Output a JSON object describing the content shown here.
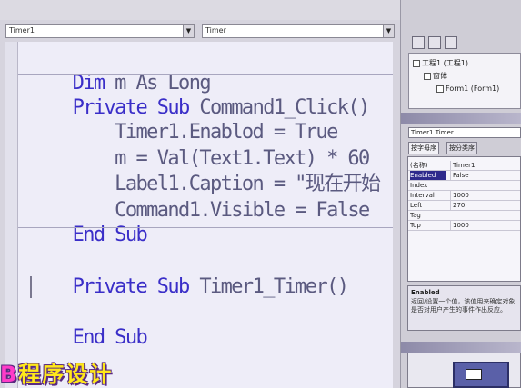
{
  "code_window": {
    "object_combo": "Timer1",
    "procedure_combo": "Timer",
    "lines": [
      {
        "kw": "Dim",
        "rest": " m As Long"
      },
      {
        "kw": "Private Sub",
        "rest": " Command1_Click()"
      },
      {
        "kw": "",
        "rest": "    Timer1.Enablod = True"
      },
      {
        "kw": "",
        "rest": "    m = Val(Text1.Text) * 60"
      },
      {
        "kw": "",
        "rest": "    Label1.Caption = \"现在开始"
      },
      {
        "kw": "",
        "rest": "    Command1.Visible = False"
      },
      {
        "kw": "End Sub",
        "rest": ""
      },
      {
        "kw": "Private Sub",
        "rest": " Timer1_Timer()"
      },
      {
        "kw": "End Sub",
        "rest": ""
      }
    ]
  },
  "overlay": {
    "prefix": "B",
    "title": "程序设计"
  },
  "project": {
    "tree": [
      "工程1 (工程1)",
      "窗体",
      "Form1 (Form1)"
    ]
  },
  "properties": {
    "object": "Timer1 Timer",
    "tabs": [
      "按字母序",
      "按分类序"
    ],
    "rows": [
      {
        "name": "(名称)",
        "value": "Timer1"
      },
      {
        "name": "Enabled",
        "value": "False"
      },
      {
        "name": "Index",
        "value": ""
      },
      {
        "name": "Interval",
        "value": "1000"
      },
      {
        "name": "Left",
        "value": "270"
      },
      {
        "name": "Tag",
        "value": ""
      },
      {
        "name": "Top",
        "value": "1000"
      }
    ],
    "selected": "Enabled",
    "description_title": "Enabled",
    "description_text": "返回/设置一个值，该值用来确定对象是否对用户产生的事件作出反应。"
  },
  "colors": {
    "keyword": "#3a2ec8",
    "text": "#5b5a80",
    "logo": "#ffe81a"
  }
}
